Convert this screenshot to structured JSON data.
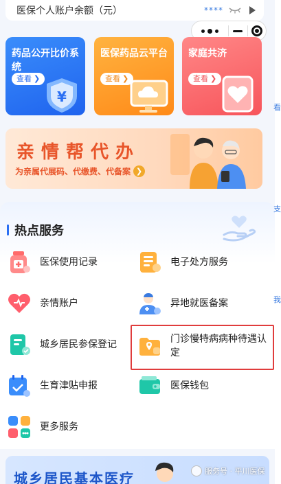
{
  "balance": {
    "label": "医保个人账户余额（元）",
    "masked": "****"
  },
  "cards": [
    {
      "title": "药品公开比价系统",
      "button": "查看",
      "icon": "yuan-shield-icon",
      "color": "#2a6ff3"
    },
    {
      "title": "医保药品云平台",
      "button": "查看",
      "icon": "cloud-screen-icon",
      "color": "#ff8a18"
    },
    {
      "title": "家庭共济",
      "button": "查看",
      "icon": "heart-card-icon",
      "color": "#f7555b"
    }
  ],
  "banner": {
    "title": "亲情帮代办",
    "subtitle": "为亲属代展码、代缴费、代备案"
  },
  "hot_services": {
    "title": "热点服务",
    "items": [
      {
        "label": "医保使用记录",
        "icon": "medicine-bottle-icon"
      },
      {
        "label": "电子处方服务",
        "icon": "prescription-icon"
      },
      {
        "label": "亲情账户",
        "icon": "heart-icon"
      },
      {
        "label": "异地就医备案",
        "icon": "doctor-icon"
      },
      {
        "label": "城乡居民参保登记",
        "icon": "document-icon"
      },
      {
        "label": "门诊慢特病病种待遇认定",
        "icon": "location-folder-icon"
      },
      {
        "label": "生育津贴申报",
        "icon": "calendar-check-icon"
      },
      {
        "label": "医保钱包",
        "icon": "wallet-icon"
      },
      {
        "label": "更多服务",
        "icon": "grid-more-icon"
      }
    ]
  },
  "bottom_banner": {
    "title": "城乡居民基本医疗"
  },
  "watermark": "服务号 · 平川医保",
  "edge_glyphs": [
    "看",
    "支",
    "我"
  ]
}
